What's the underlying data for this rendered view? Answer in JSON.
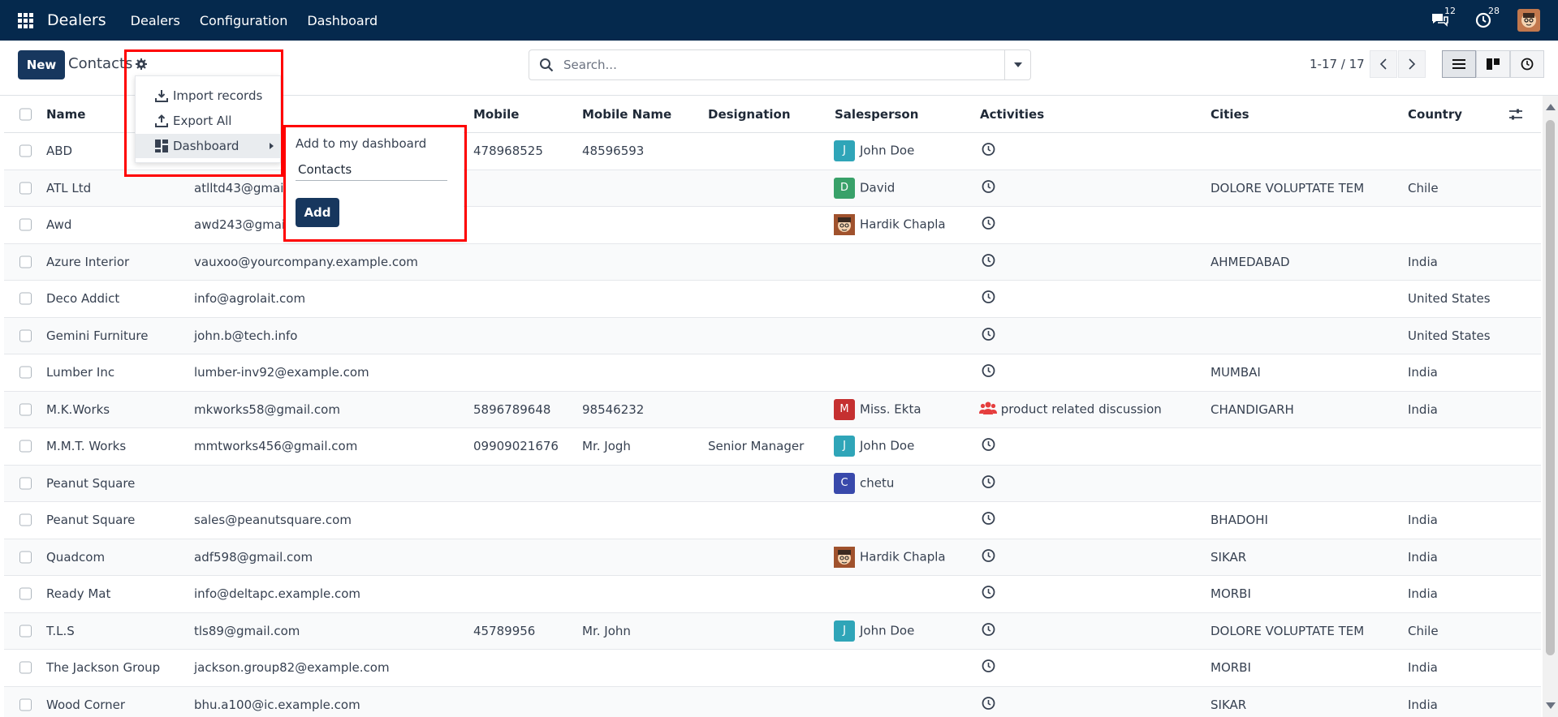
{
  "navbar": {
    "brand": "Dealers",
    "menus": [
      "Dealers",
      "Configuration",
      "Dashboard"
    ],
    "messages_count": "12",
    "activities_count": "28"
  },
  "control": {
    "new_label": "New",
    "breadcrumb": "Contacts",
    "search_placeholder": "Search...",
    "pager": "1-17 / 17"
  },
  "actions_menu": {
    "items": [
      {
        "label": "Import records",
        "icon": "download-icon"
      },
      {
        "label": "Export All",
        "icon": "upload-icon"
      },
      {
        "label": "Dashboard",
        "icon": "dashboard-icon"
      }
    ]
  },
  "dashboard_submenu": {
    "title": "Add to my dashboard",
    "input_value": "Contacts",
    "add_label": "Add"
  },
  "table": {
    "columns": [
      "Name",
      "Mobile",
      "Mobile Name",
      "Designation",
      "Salesperson",
      "Activities",
      "Cities",
      "Country"
    ],
    "rows": [
      {
        "name": "ABD",
        "email": "",
        "mobile": "478968525",
        "mobile_name": "48596593",
        "designation": "",
        "sp": "John Doe",
        "sp_initial": "J",
        "sp_color": "#2fa5b8",
        "activity": "",
        "city": "",
        "country": ""
      },
      {
        "name": "ATL Ltd",
        "email": "atlltd43@gmail",
        "mobile": "",
        "mobile_name": "",
        "designation": "",
        "sp": "David",
        "sp_initial": "D",
        "sp_color": "#38a169",
        "activity": "",
        "city": "DOLORE VOLUPTATE TEM",
        "country": "Chile"
      },
      {
        "name": "Awd",
        "email": "awd243@gmai",
        "mobile": "",
        "mobile_name": "",
        "designation": "",
        "sp": "Hardik Chapla",
        "sp_initial": "",
        "sp_color": "photo",
        "activity": "",
        "city": "",
        "country": ""
      },
      {
        "name": "Azure Interior",
        "email": "vauxoo@yourcompany.example.com",
        "mobile": "",
        "mobile_name": "",
        "designation": "",
        "sp": "",
        "sp_initial": "",
        "sp_color": "",
        "activity": "",
        "city": "AHMEDABAD",
        "country": "India"
      },
      {
        "name": "Deco Addict",
        "email": "info@agrolait.com",
        "mobile": "",
        "mobile_name": "",
        "designation": "",
        "sp": "",
        "sp_initial": "",
        "sp_color": "",
        "activity": "",
        "city": "",
        "country": "United States"
      },
      {
        "name": "Gemini Furniture",
        "email": "john.b@tech.info",
        "mobile": "",
        "mobile_name": "",
        "designation": "",
        "sp": "",
        "sp_initial": "",
        "sp_color": "",
        "activity": "",
        "city": "",
        "country": "United States"
      },
      {
        "name": "Lumber Inc",
        "email": "lumber-inv92@example.com",
        "mobile": "",
        "mobile_name": "",
        "designation": "",
        "sp": "",
        "sp_initial": "",
        "sp_color": "",
        "activity": "",
        "city": "MUMBAI",
        "country": "India"
      },
      {
        "name": "M.K.Works",
        "email": "mkworks58@gmail.com",
        "mobile": "5896789648",
        "mobile_name": "98546232",
        "designation": "",
        "sp": "Miss. Ekta",
        "sp_initial": "M",
        "sp_color": "#c53030",
        "activity": "product related discussion",
        "city": "CHANDIGARH",
        "country": "India"
      },
      {
        "name": "M.M.T. Works",
        "email": "mmtworks456@gmail.com",
        "mobile": "09909021676",
        "mobile_name": "Mr. Jogh",
        "designation": "Senior Manager",
        "sp": "John Doe",
        "sp_initial": "J",
        "sp_color": "#2fa5b8",
        "activity": "",
        "city": "",
        "country": ""
      },
      {
        "name": "Peanut Square",
        "email": "",
        "mobile": "",
        "mobile_name": "",
        "designation": "",
        "sp": "chetu",
        "sp_initial": "C",
        "sp_color": "#3949ab",
        "activity": "",
        "city": "",
        "country": ""
      },
      {
        "name": "Peanut Square",
        "email": "sales@peanutsquare.com",
        "mobile": "",
        "mobile_name": "",
        "designation": "",
        "sp": "",
        "sp_initial": "",
        "sp_color": "",
        "activity": "",
        "city": "BHADOHI",
        "country": "India"
      },
      {
        "name": "Quadcom",
        "email": "adf598@gmail.com",
        "mobile": "",
        "mobile_name": "",
        "designation": "",
        "sp": "Hardik Chapla",
        "sp_initial": "",
        "sp_color": "photo",
        "activity": "",
        "city": "SIKAR",
        "country": "India"
      },
      {
        "name": "Ready Mat",
        "email": "info@deltapc.example.com",
        "mobile": "",
        "mobile_name": "",
        "designation": "",
        "sp": "",
        "sp_initial": "",
        "sp_color": "",
        "activity": "",
        "city": "MORBI",
        "country": "India"
      },
      {
        "name": "T.L.S",
        "email": "tls89@gmail.com",
        "mobile": "45789956",
        "mobile_name": "Mr. John",
        "designation": "",
        "sp": "John Doe",
        "sp_initial": "J",
        "sp_color": "#2fa5b8",
        "activity": "",
        "city": "DOLORE VOLUPTATE TEM",
        "country": "Chile"
      },
      {
        "name": "The Jackson Group",
        "email": "jackson.group82@example.com",
        "mobile": "",
        "mobile_name": "",
        "designation": "",
        "sp": "",
        "sp_initial": "",
        "sp_color": "",
        "activity": "",
        "city": "MORBI",
        "country": "India"
      },
      {
        "name": "Wood Corner",
        "email": "bhu.a100@ic.example.com",
        "mobile": "",
        "mobile_name": "",
        "designation": "",
        "sp": "",
        "sp_initial": "",
        "sp_color": "",
        "activity": "",
        "city": "SIKAR",
        "country": "India"
      }
    ]
  },
  "colors": {
    "navbar": "#05294d",
    "primary_button": "#17375e",
    "highlight": "#ff0000"
  }
}
